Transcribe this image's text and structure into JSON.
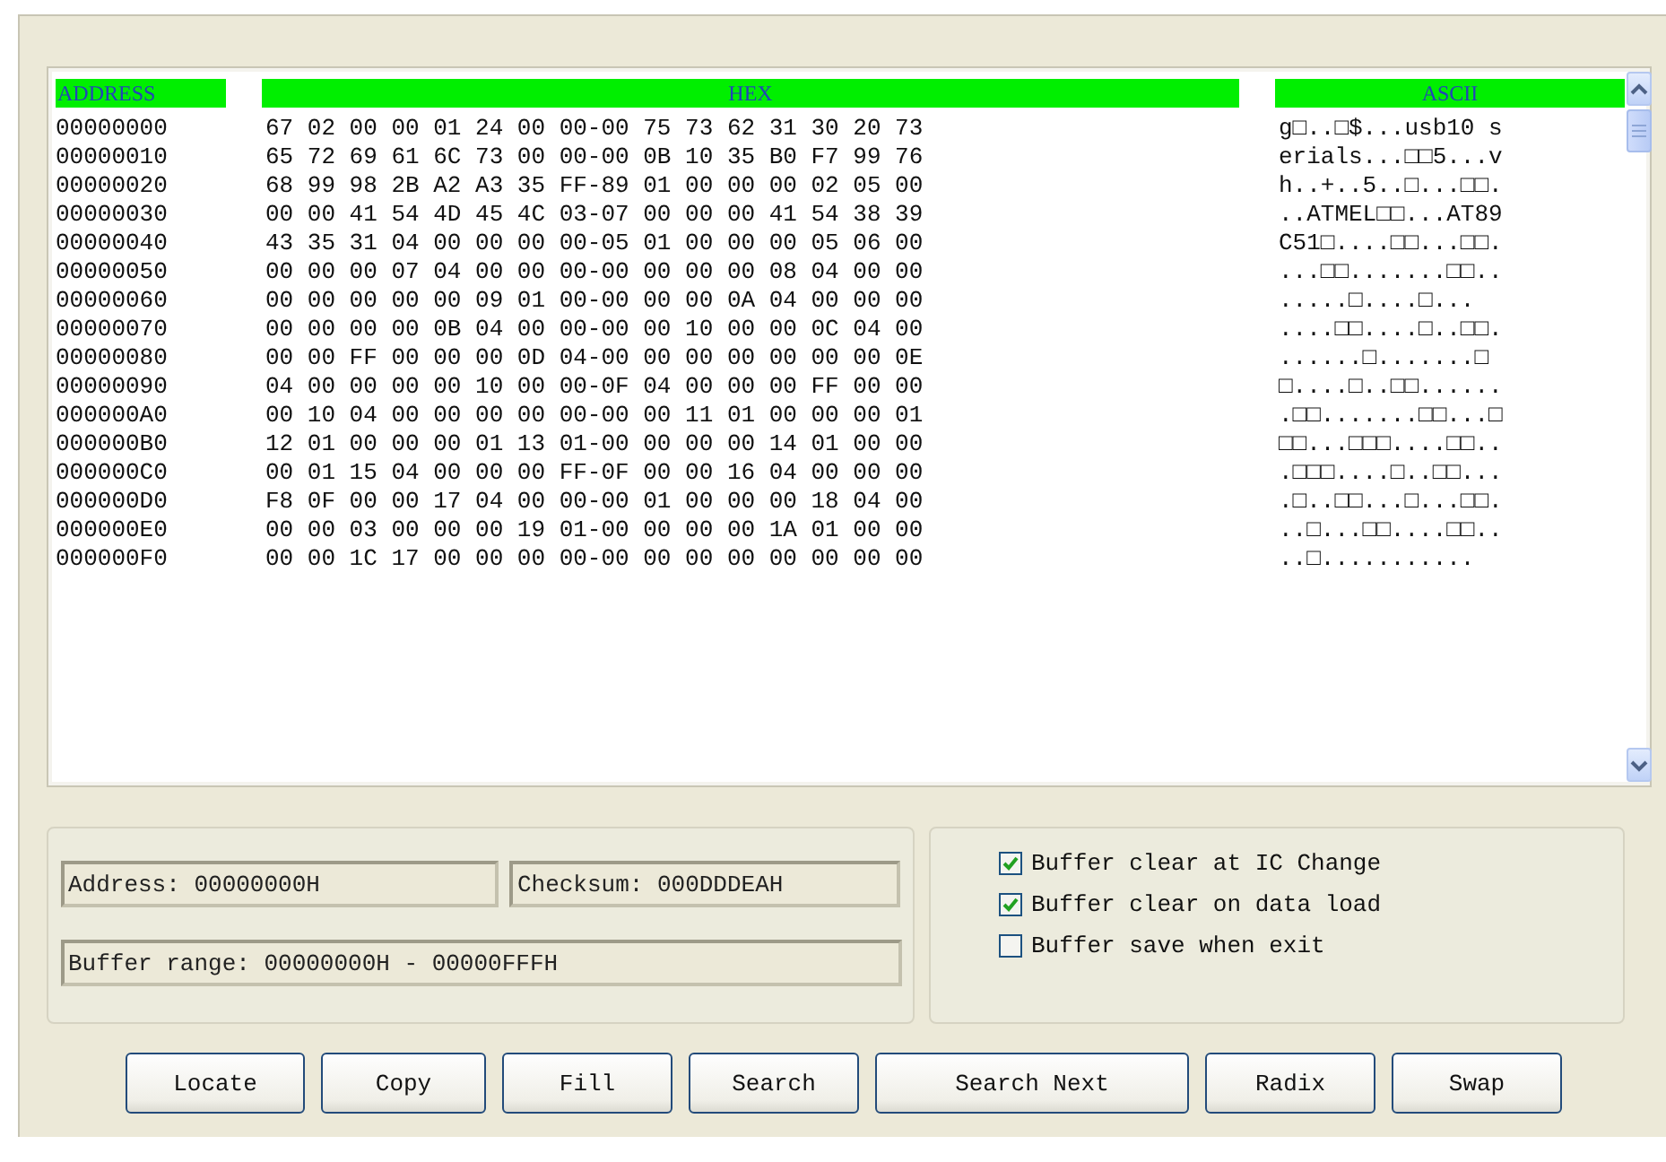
{
  "columns": [
    "ADDRESS",
    "HEX",
    "ASCII"
  ],
  "rows": [
    {
      "address": "00000000",
      "hex": "67 02 00 00 01 24 00 00-00 75 73 62 31 30 20 73",
      "ascii": "g□..□$...usb10 s"
    },
    {
      "address": "00000010",
      "hex": "65 72 69 61 6C 73 00 00-00 0B 10 35 B0 F7 99 76",
      "ascii": "erials...□□5...v"
    },
    {
      "address": "00000020",
      "hex": "68 99 98 2B A2 A3 35 FF-89 01 00 00 00 02 05 00",
      "ascii": "h..+..5..□...□□."
    },
    {
      "address": "00000030",
      "hex": "00 00 41 54 4D 45 4C 03-07 00 00 00 41 54 38 39",
      "ascii": "..ATMEL□□...AT89"
    },
    {
      "address": "00000040",
      "hex": "43 35 31 04 00 00 00 00-05 01 00 00 00 05 06 00",
      "ascii": "C51□....□□...□□."
    },
    {
      "address": "00000050",
      "hex": "00 00 00 07 04 00 00 00-00 00 00 00 08 04 00 00",
      "ascii": "...□□.......□□.."
    },
    {
      "address": "00000060",
      "hex": "00 00 00 00 00 09 01 00-00 00 00 0A 04 00 00 00",
      "ascii": ".....□....□..."
    },
    {
      "address": "00000070",
      "hex": "00 00 00 00 0B 04 00 00-00 00 10 00 00 0C 04 00",
      "ascii": "....□□....□..□□."
    },
    {
      "address": "00000080",
      "hex": "00 00 FF 00 00 00 0D 04-00 00 00 00 00 00 00 0E",
      "ascii": "......□.......□"
    },
    {
      "address": "00000090",
      "hex": "04 00 00 00 00 10 00 00-0F 04 00 00 00 FF 00 00",
      "ascii": "□....□..□□......"
    },
    {
      "address": "000000A0",
      "hex": "00 10 04 00 00 00 00 00-00 00 11 01 00 00 00 01",
      "ascii": ".□□.......□□...□"
    },
    {
      "address": "000000B0",
      "hex": "12 01 00 00 00 01 13 01-00 00 00 00 14 01 00 00",
      "ascii": "□□...□□□....□□.."
    },
    {
      "address": "000000C0",
      "hex": "00 01 15 04 00 00 00 FF-0F 00 00 16 04 00 00 00",
      "ascii": ".□□□....□..□□..."
    },
    {
      "address": "000000D0",
      "hex": "F8 0F 00 00 17 04 00 00-00 01 00 00 00 18 04 00",
      "ascii": ".□..□□...□...□□."
    },
    {
      "address": "000000E0",
      "hex": "00 00 03 00 00 00 19 01-00 00 00 00 1A 01 00 00",
      "ascii": "..□...□□....□□.."
    },
    {
      "address": "000000F0",
      "hex": "00 00 1C 17 00 00 00 00-00 00 00 00 00 00 00 00",
      "ascii": "..□..........."
    }
  ],
  "fields": {
    "address": "Address: 00000000H",
    "checksum": "Checksum: 000DDDEAH",
    "buffer_range": "Buffer range: 00000000H - 00000FFFH"
  },
  "options": [
    {
      "label": "Buffer clear at IC Change",
      "checked": true
    },
    {
      "label": "Buffer clear on data load",
      "checked": true
    },
    {
      "label": "Buffer save when exit",
      "checked": false
    }
  ],
  "buttons": [
    "Locate",
    "Copy",
    "Fill",
    "Search",
    "Search Next",
    "Radix",
    "Swap"
  ]
}
